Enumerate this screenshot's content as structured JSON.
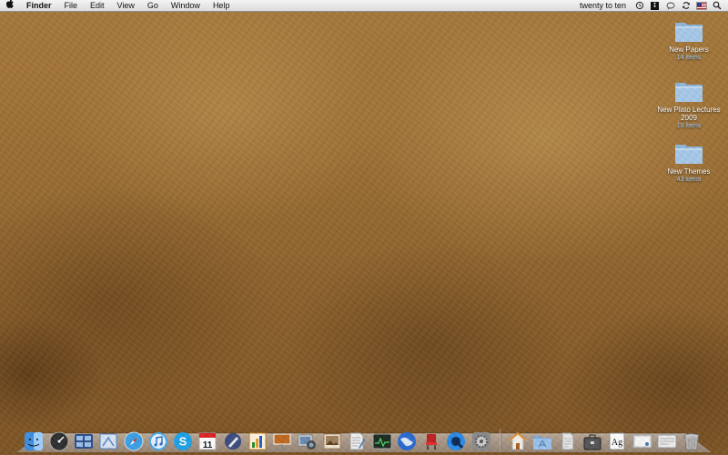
{
  "menubar": {
    "apple_glyph": "",
    "app_name": "Finder",
    "menus": [
      "File",
      "Edit",
      "View",
      "Go",
      "Window",
      "Help"
    ],
    "clock": "twenty to ten",
    "status_icons": [
      "time-machine-icon",
      "script-menu-icon",
      "chat-bubble-icon",
      "sync-icon",
      "us-flag-icon",
      "spotlight-icon"
    ]
  },
  "desktop": {
    "folders": [
      {
        "name": "New Papers",
        "sub": "14 items"
      },
      {
        "name": "New Plato Lectures 2009",
        "sub": "10 items"
      },
      {
        "name": "New Themes",
        "sub": "43 items"
      }
    ]
  },
  "dock": {
    "apps": [
      {
        "icon": "finder-icon",
        "color": "#3d8fe0"
      },
      {
        "icon": "dashboard-icon",
        "color": "#333333"
      },
      {
        "icon": "spaces-icon",
        "color": "#2b4e8a"
      },
      {
        "icon": "mail-icon",
        "color": "#5a88c8"
      },
      {
        "icon": "safari-icon",
        "color": "#3aa0e8"
      },
      {
        "icon": "itunes-icon",
        "color": "#4aa8e8"
      },
      {
        "icon": "skype-icon",
        "color": "#1da1e8"
      },
      {
        "icon": "ical-icon",
        "color": "#ffffff",
        "label": "11"
      },
      {
        "icon": "pen-app-icon",
        "color": "#3a4c80"
      },
      {
        "icon": "graph-app-icon",
        "color": "#e0a030"
      },
      {
        "icon": "keynote-icon",
        "color": "#c06a20"
      },
      {
        "icon": "iphoto-icon",
        "color": "#6a8ab0"
      },
      {
        "icon": "photo-viewer-icon",
        "color": "#a08060"
      },
      {
        "icon": "textedit-icon",
        "color": "#f0f0f0"
      },
      {
        "icon": "activity-monitor-icon",
        "color": "#2a6b3a"
      },
      {
        "icon": "google-earth-icon",
        "color": "#2a6ad0"
      },
      {
        "icon": "chair-app-icon",
        "color": "#c02020"
      },
      {
        "icon": "quicktime-icon",
        "color": "#2a8ae8"
      },
      {
        "icon": "system-preferences-icon",
        "color": "#8a8a8a"
      }
    ],
    "stacks": [
      {
        "icon": "home-icon",
        "color": "#d88a30"
      },
      {
        "icon": "applications-folder-icon",
        "color": "#7aa9d8"
      },
      {
        "icon": "document-icon",
        "color": "#e8e8e8"
      },
      {
        "icon": "briefcase-icon",
        "color": "#555555"
      },
      {
        "icon": "font-book-icon",
        "color": "#ffffff",
        "label": "Ag"
      },
      {
        "icon": "preview-icon",
        "color": "#dddddd"
      },
      {
        "icon": "textedit-doc-icon",
        "color": "#eeeeee"
      },
      {
        "icon": "trash-icon",
        "color": "#bbbbbb"
      }
    ]
  }
}
